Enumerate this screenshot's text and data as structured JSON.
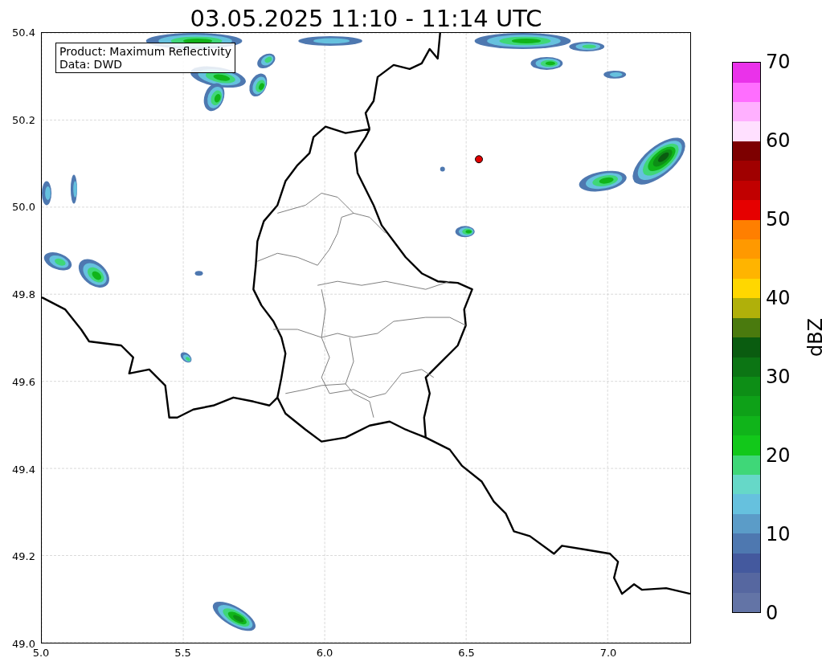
{
  "title": "03.05.2025 11:10 - 11:14 UTC",
  "info_box": {
    "lines": [
      "Product: Maximum Reflectivity",
      "Data: DWD"
    ]
  },
  "map": {
    "x_ticks": [
      "5.0",
      "5.5",
      "6.0",
      "6.5",
      "7.0"
    ],
    "y_ticks": [
      "50.4",
      "50.2",
      "50.0",
      "49.8",
      "49.6",
      "49.4",
      "49.2",
      "49.0"
    ]
  },
  "colorbar": {
    "label": "dBZ",
    "segments": [
      {
        "color": "#6374a6"
      },
      {
        "color": "#5667a0"
      },
      {
        "color": "#44599e"
      },
      {
        "color": "#4e78b0"
      },
      {
        "color": "#5b9cc8"
      },
      {
        "color": "#66c1de"
      },
      {
        "color": "#66d8c8"
      },
      {
        "color": "#3fd778"
      },
      {
        "color": "#12c81a"
      },
      {
        "color": "#10b41a"
      },
      {
        "color": "#0ea118"
      },
      {
        "color": "#0d8e16"
      },
      {
        "color": "#0c7514"
      },
      {
        "color": "#0a5c10"
      },
      {
        "color": "#4a7a0e"
      },
      {
        "color": "#b0b00a"
      },
      {
        "color": "#ffd700"
      },
      {
        "color": "#ffb400"
      },
      {
        "color": "#ff9900"
      },
      {
        "color": "#ff7f00"
      },
      {
        "color": "#e60000"
      },
      {
        "color": "#c10000"
      },
      {
        "color": "#a00000"
      },
      {
        "color": "#7d0000"
      },
      {
        "color": "#ffe0ff"
      },
      {
        "color": "#ffb0ff"
      },
      {
        "color": "#ff6eff"
      },
      {
        "color": "#ea32ea"
      }
    ],
    "ticks": [
      "70",
      "60",
      "50",
      "40",
      "30",
      "20",
      "10",
      "0"
    ]
  }
}
